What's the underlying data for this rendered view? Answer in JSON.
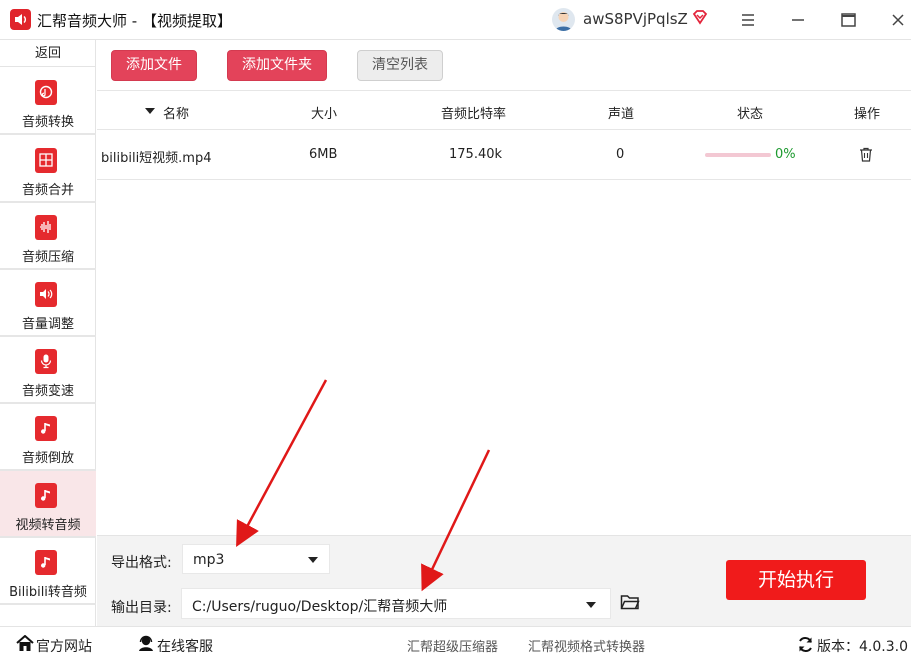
{
  "window": {
    "title": "汇帮音频大师  - 【视频提取】",
    "username": "awS8PVjPqlsZ"
  },
  "sidebar": {
    "back_label": "返回",
    "items": [
      {
        "label": "音频转换",
        "icon": "audio-convert-icon"
      },
      {
        "label": "音频合并",
        "icon": "audio-merge-icon"
      },
      {
        "label": "音频压缩",
        "icon": "audio-compress-icon"
      },
      {
        "label": "音量调整",
        "icon": "volume-adjust-icon"
      },
      {
        "label": "音频变速",
        "icon": "audio-speed-icon"
      },
      {
        "label": "音频倒放",
        "icon": "audio-reverse-icon"
      },
      {
        "label": "视频转音频",
        "icon": "video-to-audio-icon",
        "active": true
      },
      {
        "label": "Bilibili转音频",
        "icon": "bilibili-to-audio-icon"
      }
    ]
  },
  "toolbar": {
    "add_file": "添加文件",
    "add_folder": "添加文件夹",
    "clear_list": "清空列表"
  },
  "table": {
    "columns": [
      "名称",
      "大小",
      "音频比特率",
      "声道",
      "状态",
      "操作"
    ],
    "rows": [
      {
        "name": "bilibili短视频.mp4",
        "size": "6MB",
        "bitrate": "175.40k",
        "channel": "0",
        "progress": 0,
        "status": "0%"
      }
    ]
  },
  "settings": {
    "format_label": "导出格式:",
    "format_value": "mp3",
    "output_label": "输出目录:",
    "output_path": "C:/Users/ruguo/Desktop/汇帮音频大师",
    "start_button": "开始执行"
  },
  "footer": {
    "site": "官方网站",
    "service": "在线客服",
    "compressor": "汇帮超级压缩器",
    "converter": "汇帮视频格式转换器",
    "version": "版本：4.0.3.0"
  },
  "colors": {
    "accent": "#e3435a",
    "start": "#f01b1b",
    "progress_text": "#1d9a2f",
    "sidebar_active": "#f9e6e8"
  }
}
